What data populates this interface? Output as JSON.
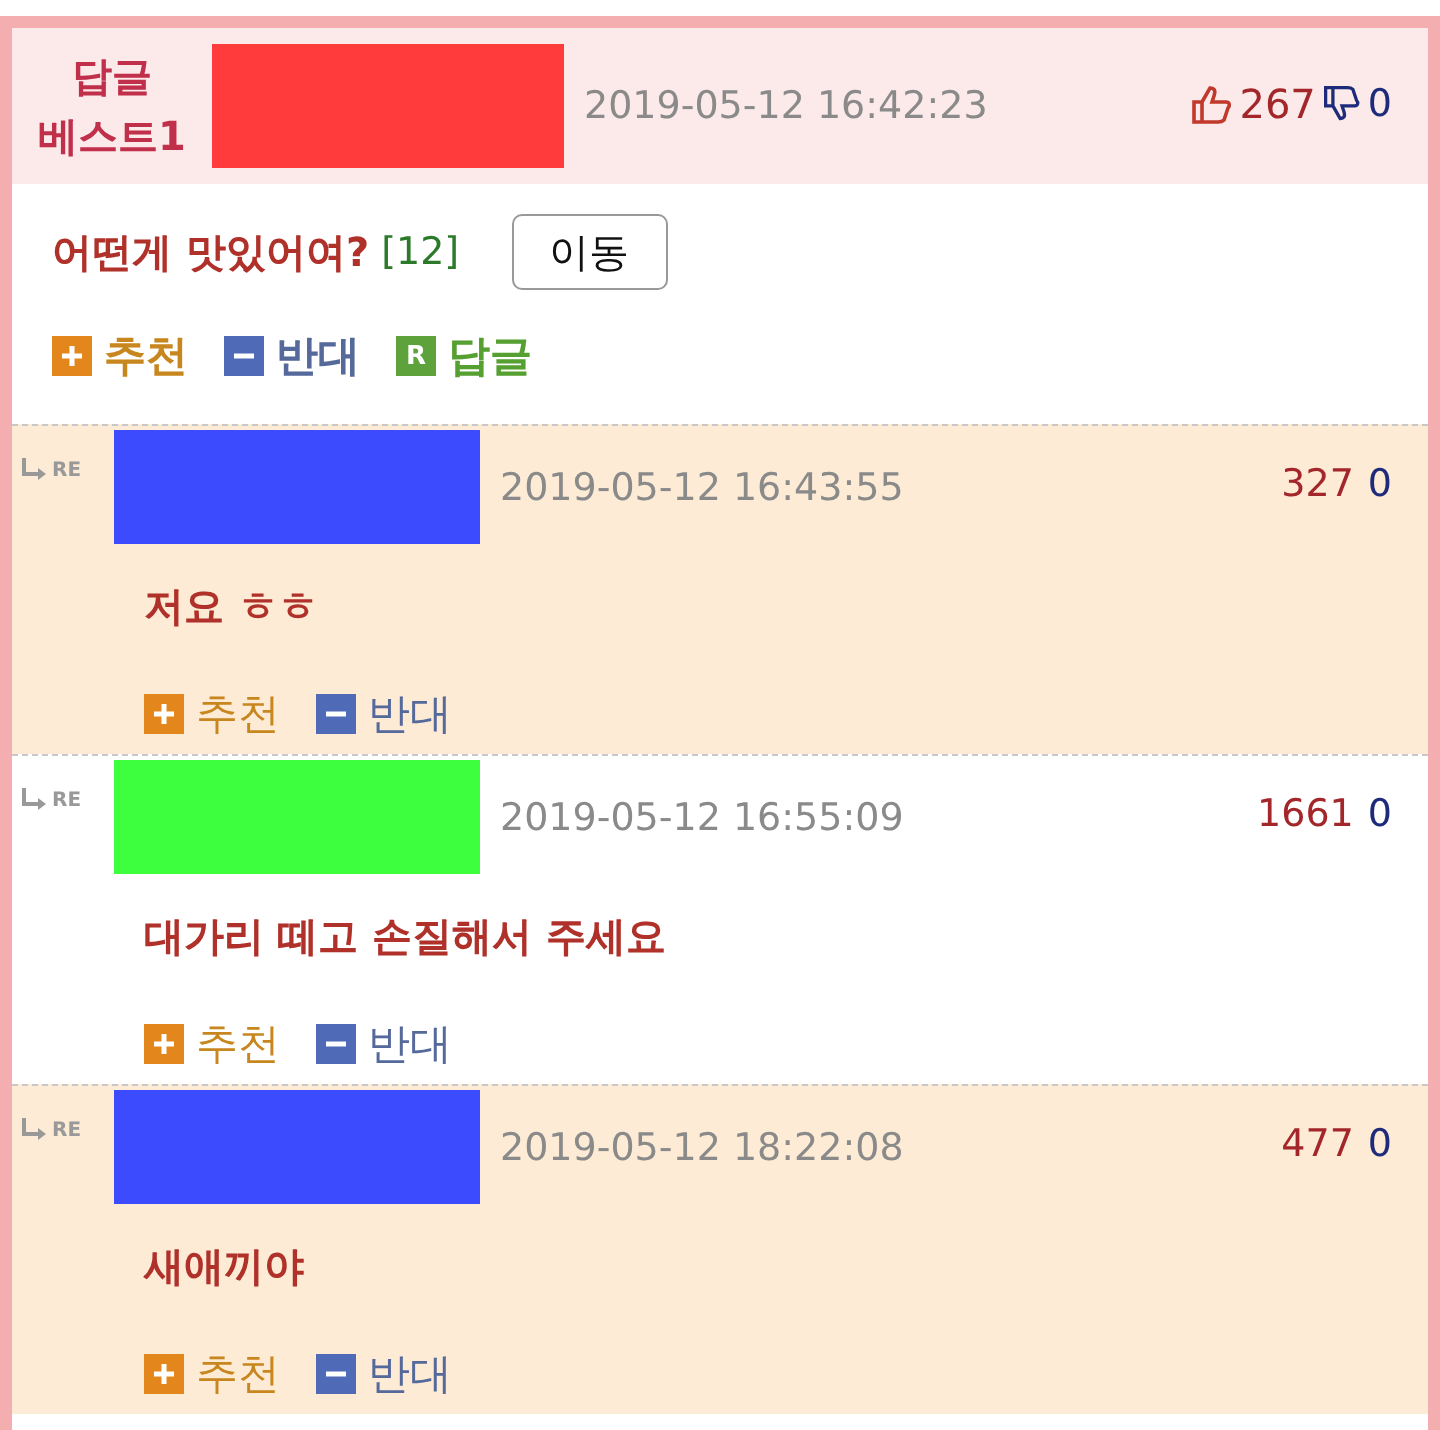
{
  "best_comment": {
    "badge_lines": [
      "답글",
      "베스트1"
    ],
    "color": "#ff3b3b",
    "date": "2019-05-12 16:42:23",
    "upvotes": "267",
    "downvotes": "0",
    "title": "어떤게 맛있어여?",
    "reply_count": "[12]",
    "move_button": "이동",
    "actions": [
      {
        "kind": "recommend",
        "label": "추천"
      },
      {
        "kind": "oppose",
        "label": "반대"
      },
      {
        "kind": "reply",
        "label": "답글",
        "icon_text": "R"
      }
    ]
  },
  "replies": [
    {
      "tag": "RE",
      "shaded": true,
      "color": "#3d4bff",
      "date": "2019-05-12 16:43:55",
      "upvotes": "327",
      "downvotes": "0",
      "text": "저요 ㅎㅎ",
      "actions": [
        {
          "kind": "recommend",
          "label": "추천"
        },
        {
          "kind": "oppose",
          "label": "반대"
        }
      ]
    },
    {
      "tag": "RE",
      "shaded": false,
      "color": "#3dff3d",
      "date": "2019-05-12 16:55:09",
      "upvotes": "1661",
      "downvotes": "0",
      "text": "대가리 떼고 손질해서 주세요",
      "actions": [
        {
          "kind": "recommend",
          "label": "추천"
        },
        {
          "kind": "oppose",
          "label": "반대"
        }
      ]
    },
    {
      "tag": "RE",
      "shaded": true,
      "color": "#3d4bff",
      "date": "2019-05-12 18:22:08",
      "upvotes": "477",
      "downvotes": "0",
      "text": "새애끼야",
      "actions": [
        {
          "kind": "recommend",
          "label": "추천"
        },
        {
          "kind": "oppose",
          "label": "반대"
        }
      ]
    }
  ]
}
